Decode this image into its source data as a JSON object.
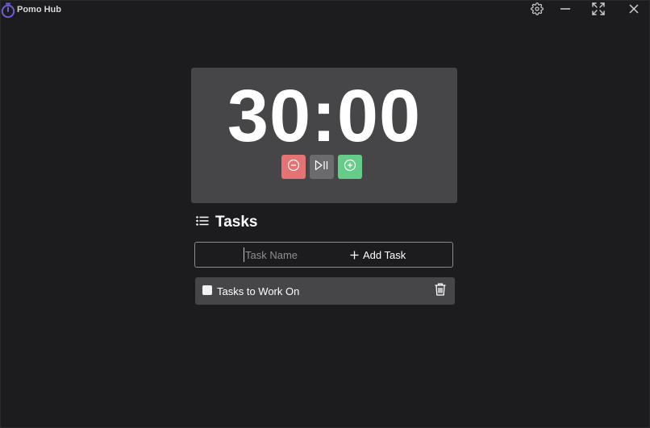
{
  "app": {
    "title": "Pomo Hub",
    "accent_color": "#6b5fd3"
  },
  "window_controls": {
    "settings_icon": "gear-icon",
    "minimize_icon": "minimize-icon",
    "fullscreen_icon": "fullscreen-icon",
    "close_icon": "close-icon"
  },
  "timer": {
    "display": "30:00",
    "controls": [
      {
        "name": "decrease",
        "icon": "minus-circle-icon",
        "color": "#e57373"
      },
      {
        "name": "play-pause",
        "icon": "play-pause-icon",
        "color": "#6b6b6e"
      },
      {
        "name": "increase",
        "icon": "plus-circle-icon",
        "color": "#66cc8a"
      }
    ]
  },
  "tasks": {
    "header": "Tasks",
    "header_icon": "list-icon",
    "input_placeholder": "Task Name",
    "input_value": "",
    "add_label": "Add Task",
    "items": [
      {
        "label": "Tasks to Work On",
        "checked": false
      }
    ]
  }
}
